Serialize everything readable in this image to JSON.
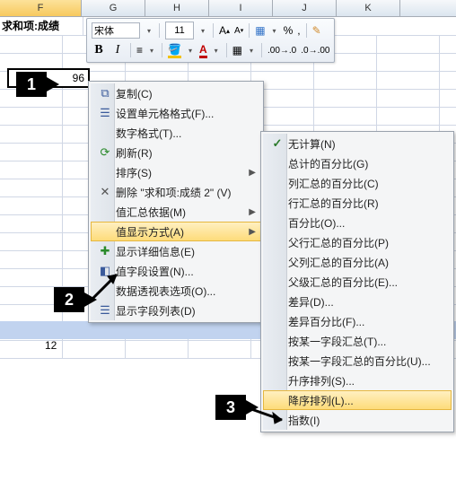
{
  "columns": [
    "F",
    "G",
    "H",
    "I",
    "J",
    "K"
  ],
  "header_cell": "求和项:成绩",
  "selected_cell_value": "96",
  "total_value": "12",
  "mini_toolbar": {
    "font_name": "宋体",
    "font_size": "11",
    "bold": "B",
    "italic": "I",
    "percent": "%",
    "comma": ","
  },
  "menu1": {
    "copy": "复制(C)",
    "format_cells": "设置单元格格式(F)...",
    "number_format": "数字格式(T)...",
    "refresh": "刷新(R)",
    "sort": "排序(S)",
    "delete": "删除 \"求和项:成绩 2\" (V)",
    "summarize": "值汇总依据(M)",
    "show_values_as": "值显示方式(A)",
    "show_detail": "显示详细信息(E)",
    "field_settings": "值字段设置(N)...",
    "pivot_options": "数据透视表选项(O)...",
    "show_field_list": "显示字段列表(D)"
  },
  "menu2": {
    "no_calc": "无计算(N)",
    "pct_grand": "总计的百分比(G)",
    "pct_col": "列汇总的百分比(C)",
    "pct_row": "行汇总的百分比(R)",
    "pct_of": "百分比(O)...",
    "pct_parent_row": "父行汇总的百分比(P)",
    "pct_parent_col": "父列汇总的百分比(A)",
    "pct_parent": "父级汇总的百分比(E)...",
    "diff": "差异(D)...",
    "pct_diff": "差异百分比(F)...",
    "running_total": "按某一字段汇总(T)...",
    "pct_running": "按某一字段汇总的百分比(U)...",
    "rank_asc": "升序排列(S)...",
    "rank_desc": "降序排列(L)...",
    "index": "指数(I)"
  },
  "callouts": {
    "c1": "1",
    "c2": "2",
    "c3": "3"
  }
}
